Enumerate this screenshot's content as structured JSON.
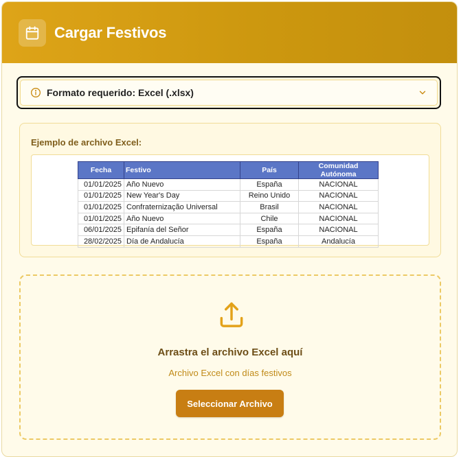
{
  "header": {
    "title": "Cargar Festivos",
    "icon": "calendar-icon",
    "gradient": [
      "#dea418",
      "#c38f0d"
    ]
  },
  "format_notice": {
    "label": "Formato requerido: Excel (.xlsx)",
    "icon": "info-icon",
    "expand_icon": "chevron-down-icon"
  },
  "example": {
    "title": "Ejemplo de archivo Excel:",
    "table": {
      "columns": [
        "Fecha",
        "Festivo",
        "País",
        "Comunidad Autónoma"
      ],
      "rows": [
        [
          "01/01/2025",
          "Año Nuevo",
          "España",
          "NACIONAL"
        ],
        [
          "01/01/2025",
          "New Year's Day",
          "Reino Unido",
          "NACIONAL"
        ],
        [
          "01/01/2025",
          "Confraternização Universal",
          "Brasil",
          "NACIONAL"
        ],
        [
          "01/01/2025",
          "Año Nuevo",
          "Chile",
          "NACIONAL"
        ],
        [
          "06/01/2025",
          "Epifanía del Señor",
          "España",
          "NACIONAL"
        ],
        [
          "28/02/2025",
          "Día de Andalucía",
          "España",
          "Andalucía"
        ]
      ]
    }
  },
  "dropzone": {
    "icon": "upload-icon",
    "title": "Arrastra el archivo Excel aquí",
    "subtitle": "Archivo Excel con días festivos",
    "button_label": "Seleccionar Archivo"
  },
  "colors": {
    "accent": "#c87e13",
    "panel_bg": "#fffbea",
    "table_header": "#5b76c6"
  }
}
